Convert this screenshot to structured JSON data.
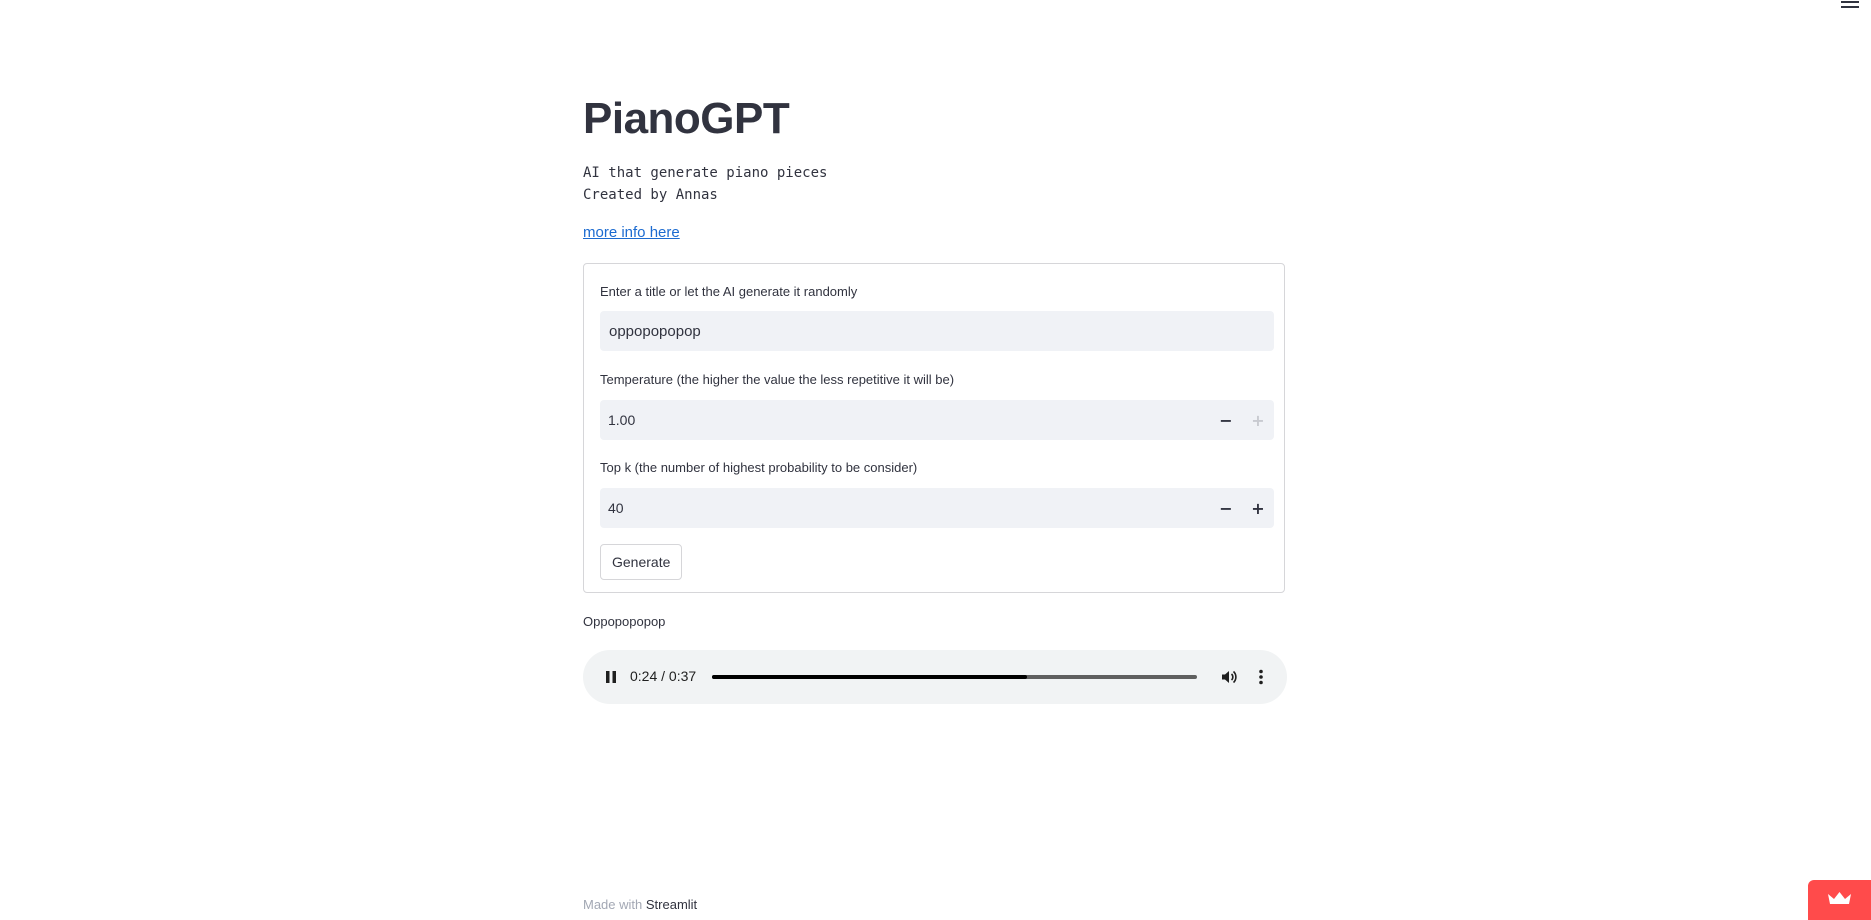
{
  "app": {
    "title": "PianoGPT",
    "description": "AI that generate piano pieces\nCreated by Annas",
    "more_info_link": "more info here"
  },
  "form": {
    "title_field": {
      "label": "Enter a title or let the AI generate it randomly",
      "value": "oppopopopop"
    },
    "temperature_field": {
      "label": "Temperature (the higher the value the less repetitive it will be)",
      "value": "1.00",
      "decrement": "−",
      "increment": "+"
    },
    "topk_field": {
      "label": "Top k (the number of highest probability to be consider)",
      "value": "40",
      "decrement": "−",
      "increment": "+"
    },
    "generate_label": "Generate"
  },
  "audio": {
    "title": "Oppopopopop",
    "time": "0:24 / 0:37",
    "progress_fraction": 0.649,
    "state": "playing"
  },
  "footer": {
    "made_with": "Made with ",
    "brand": "Streamlit"
  },
  "icons": {
    "menu": "hamburger-icon",
    "pause": "pause-icon",
    "volume": "volume-icon",
    "more": "more-vertical-icon",
    "badge": "crown-icon"
  },
  "colors": {
    "link": "#1c6bd0",
    "badge": "#ff4b4b",
    "input_bg": "#f0f2f6",
    "text": "#31333f"
  }
}
